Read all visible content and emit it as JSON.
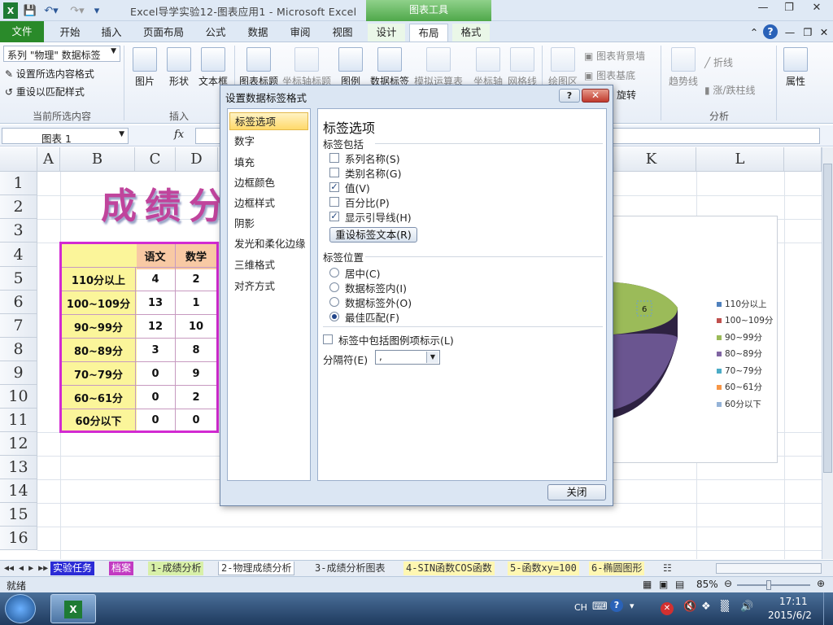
{
  "window": {
    "title": "Excel导学实验12-图表应用1 - Microsoft Excel",
    "context_tab": "图表工具"
  },
  "ribbon_tabs": [
    "文件",
    "开始",
    "插入",
    "页面布局",
    "公式",
    "数据",
    "审阅",
    "视图",
    "设计",
    "布局",
    "格式"
  ],
  "ribbon": {
    "selection_combo": "系列 \"物理\" 数据标签",
    "format_selection": "设置所选内容格式",
    "reset_style": "重设以匹配样式",
    "group_current": "当前所选内容",
    "group_insert": "插入",
    "group_analysis": "分析",
    "picture": "图片",
    "shapes": "形状",
    "textbox": "文本框",
    "chart_title": "图表标题",
    "axis_titles": "坐标轴标题",
    "legend": "图例",
    "data_labels": "数据标签",
    "data_table": "模拟运算表",
    "axes": "坐标轴",
    "gridlines": "网格线",
    "plot_area": "绘图区",
    "chart_wall": "图表背景墙",
    "chart_floor": "图表基底",
    "rotation": "旋转",
    "trendline": "趋势线",
    "lines": "折线",
    "updown_bars": "涨/跌柱线",
    "properties": "属性"
  },
  "formula_bar": {
    "name_box": "图表 1",
    "fx": "fx"
  },
  "sheet": {
    "columns": [
      "A",
      "B",
      "C",
      "D",
      "K",
      "L"
    ],
    "rows": [
      "1",
      "2",
      "3",
      "4",
      "5",
      "6",
      "7",
      "8",
      "9",
      "10",
      "11",
      "12",
      "13",
      "14",
      "15",
      "16"
    ],
    "big_title": "成绩分",
    "table": {
      "headers": [
        "语文",
        "数学"
      ],
      "rows": [
        {
          "label": "110分以上",
          "c": "4",
          "d": "2"
        },
        {
          "label": "100~109分",
          "c": "13",
          "d": "1"
        },
        {
          "label": "90~99分",
          "c": "12",
          "d": "10"
        },
        {
          "label": "80~89分",
          "c": "3",
          "d": "8"
        },
        {
          "label": "70~79分",
          "c": "0",
          "d": "9"
        },
        {
          "label": "60~61分",
          "c": "0",
          "d": "2"
        },
        {
          "label": "60分以下",
          "c": "0",
          "d": "0"
        }
      ]
    },
    "chart": {
      "label_value": "6",
      "legend": [
        {
          "name": "110分以上",
          "color": "#4f81bd"
        },
        {
          "name": "100~109分",
          "color": "#c0504d"
        },
        {
          "name": "90~99分",
          "color": "#9bbb59"
        },
        {
          "name": "80~89分",
          "color": "#8064a2"
        },
        {
          "name": "70~79分",
          "color": "#4bacc6"
        },
        {
          "name": "60~61分",
          "color": "#f79646"
        },
        {
          "name": "60分以下",
          "color": "#95b3d7"
        }
      ]
    }
  },
  "sheet_tabs": [
    "实验任务",
    "档案",
    "1-成绩分析",
    "2-物理成绩分析",
    "3-成绩分析图表",
    "4-SIN函数COS函数",
    "5-函数xy=100",
    "6-椭圆图形"
  ],
  "status": {
    "ready": "就绪",
    "zoom": "85%"
  },
  "taskbar": {
    "lang": "CH",
    "time": "17:11",
    "date": "2015/6/2"
  },
  "dialog": {
    "title": "设置数据标签格式",
    "nav": [
      "标签选项",
      "数字",
      "填充",
      "边框颜色",
      "边框样式",
      "阴影",
      "发光和柔化边缘",
      "三维格式",
      "对齐方式"
    ],
    "heading": "标签选项",
    "contains_label": "标签包括",
    "checkboxes": [
      {
        "label": "系列名称(S)",
        "checked": false
      },
      {
        "label": "类别名称(G)",
        "checked": false
      },
      {
        "label": "值(V)",
        "checked": true
      },
      {
        "label": "百分比(P)",
        "checked": false
      },
      {
        "label": "显示引导线(H)",
        "checked": true
      }
    ],
    "reset_button": "重设标签文本(R)",
    "position_label": "标签位置",
    "radios": [
      {
        "label": "居中(C)",
        "selected": false
      },
      {
        "label": "数据标签内(I)",
        "selected": false
      },
      {
        "label": "数据标签外(O)",
        "selected": false
      },
      {
        "label": "最佳匹配(F)",
        "selected": true
      }
    ],
    "legend_key": "标签中包括图例项标示(L)",
    "separator_label": "分隔符(E)",
    "separator_value": ",",
    "close_button": "关闭"
  }
}
